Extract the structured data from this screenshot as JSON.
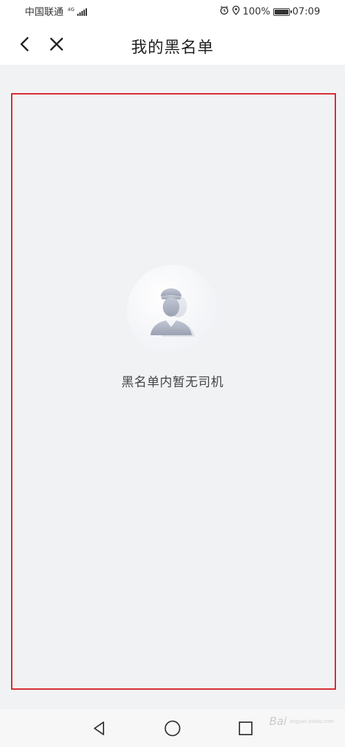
{
  "status_bar": {
    "carrier": "中国联通",
    "network": "4G",
    "battery": "100%",
    "battery_level": 1.0,
    "time": "07:09",
    "icons": [
      "signal-icon",
      "alarm-icon",
      "location-icon",
      "battery-icon"
    ]
  },
  "header": {
    "title": "我的黑名单",
    "back_icon": "chevron-left-icon",
    "close_icon": "close-icon"
  },
  "empty_state": {
    "icon": "driver-avatar-icon",
    "message": "黑名单内暂无司机"
  },
  "system_nav": {
    "icons": [
      "triangle-back-icon",
      "circle-home-icon",
      "square-recent-icon"
    ]
  },
  "watermark": {
    "text": "Bai",
    "sub": "jingyan.baidu.com"
  },
  "colors": {
    "background": "#f1f2f4",
    "highlight": "#d6262c",
    "header": "#ffffff"
  }
}
